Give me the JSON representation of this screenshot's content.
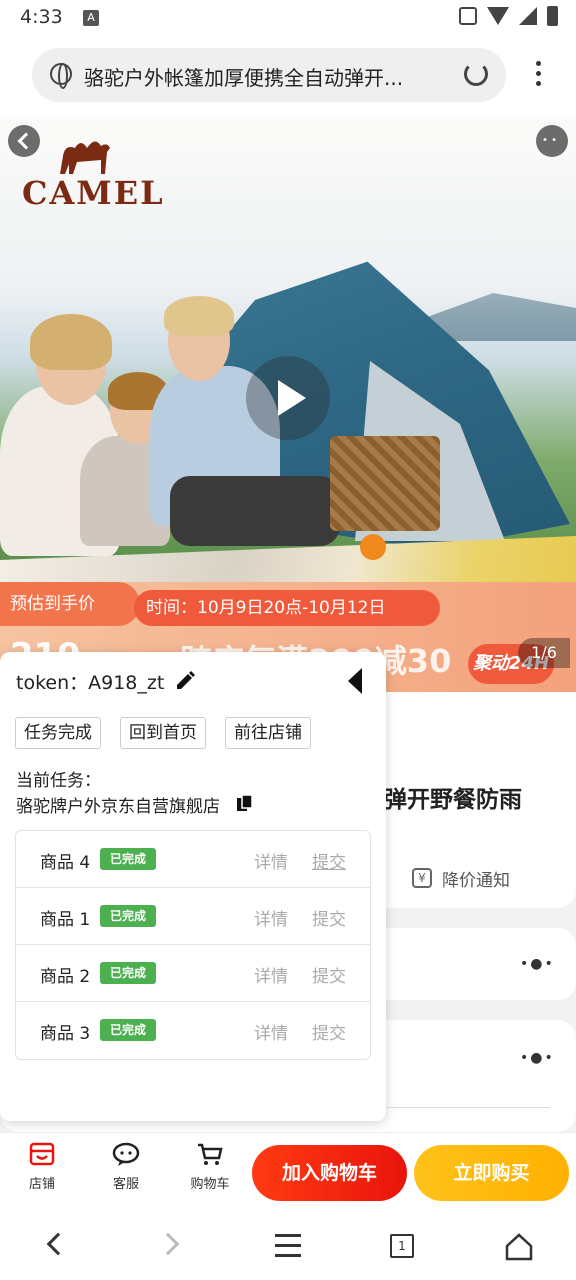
{
  "status_bar": {
    "time": "4:33",
    "notification_icon": "A"
  },
  "browser": {
    "url_text": "骆驼户外帐篷加厚便携全自动弹开..."
  },
  "hero": {
    "brand": "CAMEL",
    "price_label": "预估到手价",
    "promo_time": "时间：10月9日20点-10月12日",
    "promo_number": "219",
    "promo_text": "跨店每满300减30",
    "promo_logo": "聚动24H",
    "page_indicator": "1/6"
  },
  "product": {
    "title_fragment": "弹开野餐防雨",
    "price_notice": "降价通知"
  },
  "panel": {
    "token": "token：A918_zt",
    "buttons": {
      "task_done": "任务完成",
      "back_home": "回到首页",
      "go_shop": "前往店铺"
    },
    "current_task_label": "当前任务：",
    "current_task_name": "骆驼牌户外京东自营旗舰店",
    "items": [
      {
        "name": "商品 4",
        "status": "已完成",
        "detail": "详情",
        "submit": "提交"
      },
      {
        "name": "商品 1",
        "status": "已完成",
        "detail": "详情",
        "submit": "提交"
      },
      {
        "name": "商品 2",
        "status": "已完成",
        "detail": "详情",
        "submit": "提交"
      },
      {
        "name": "商品 3",
        "status": "已完成",
        "detail": "详情",
        "submit": "提交"
      }
    ]
  },
  "action_bar": {
    "shop": "店铺",
    "service": "客服",
    "cart": "购物车",
    "add_to_cart": "加入购物车",
    "buy_now": "立即购买"
  },
  "system_nav": {
    "tab_count": "1"
  },
  "colors": {
    "accent_red": "#e9140c",
    "accent_yellow": "#ffb100",
    "badge_green": "#4caf50"
  }
}
